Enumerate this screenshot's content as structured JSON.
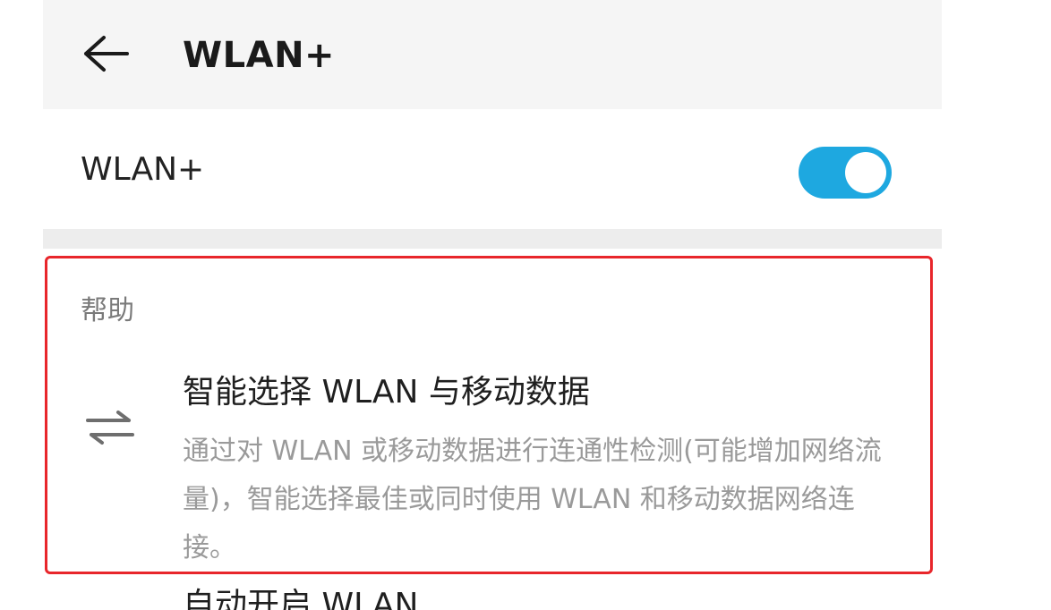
{
  "header": {
    "back_icon": "arrow-left-icon",
    "title": "WLAN+"
  },
  "toggle": {
    "label": "WLAN+",
    "state": "on",
    "accent_color": "#1ea8e0"
  },
  "help": {
    "section_label": "帮助",
    "item": {
      "icon": "swap-arrows-icon",
      "title": "智能选择 WLAN 与移动数据",
      "description": "通过对 WLAN 或移动数据进行连通性检测(可能增加网络流量)，智能选择最佳或同时使用 WLAN 和移动数据网络连接。"
    },
    "highlight_color": "#e8262b"
  },
  "next_item": {
    "title": "自动开启 WLAN"
  }
}
